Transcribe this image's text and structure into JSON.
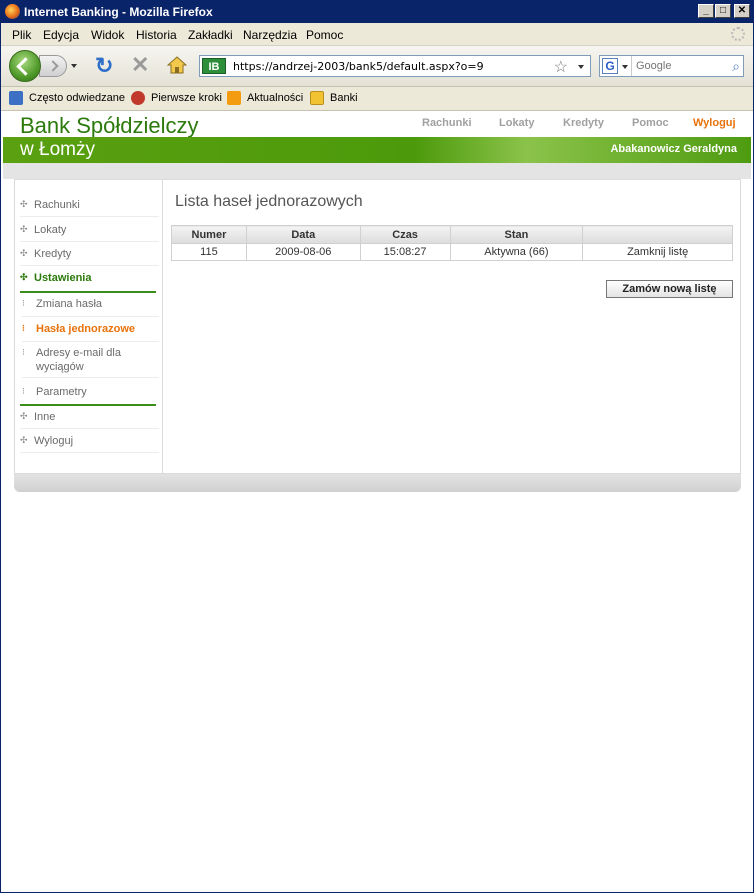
{
  "window": {
    "title": "Internet Banking - Mozilla Firefox"
  },
  "menu": [
    "Plik",
    "Edycja",
    "Widok",
    "Historia",
    "Zakładki",
    "Narzędzia",
    "Pomoc"
  ],
  "address": {
    "url": "https://andrzej-2003/bank5/default.aspx?o=9",
    "site_badge": "IB"
  },
  "search": {
    "placeholder": "Google",
    "engine_letter": "G"
  },
  "bookmarks": [
    "Często odwiedzane",
    "Pierwsze kroki",
    "Aktualności",
    "Banki"
  ],
  "bank": {
    "name": "Bank Spółdzielczy",
    "city": "w Łomży",
    "user": "Abakanowicz Geraldyna"
  },
  "topnav": [
    "Rachunki",
    "Lokaty",
    "Kredyty",
    "Pomoc",
    "Wyloguj"
  ],
  "sidebar": [
    "Rachunki",
    "Lokaty",
    "Kredyty",
    "Ustawienia",
    "Zmiana hasła",
    "Hasła jednorazowe",
    "Adresy e-mail dla wyciągów",
    "Parametry",
    "Inne",
    "Wyloguj"
  ],
  "main": {
    "title": "Lista haseł jednorazowych",
    "columns": [
      "Numer",
      "Data",
      "Czas",
      "Stan",
      ""
    ],
    "rows": [
      {
        "numer": "115",
        "data": "2009-08-06",
        "czas": "15:08:27",
        "stan": "Aktywna (66)",
        "action": "Zamknij listę"
      }
    ],
    "order_button": "Zamów nową listę"
  },
  "colors": {
    "brand_green": "#4c9a0c",
    "active_orange": "#e8720c",
    "section_green": "#2b7a0b"
  }
}
